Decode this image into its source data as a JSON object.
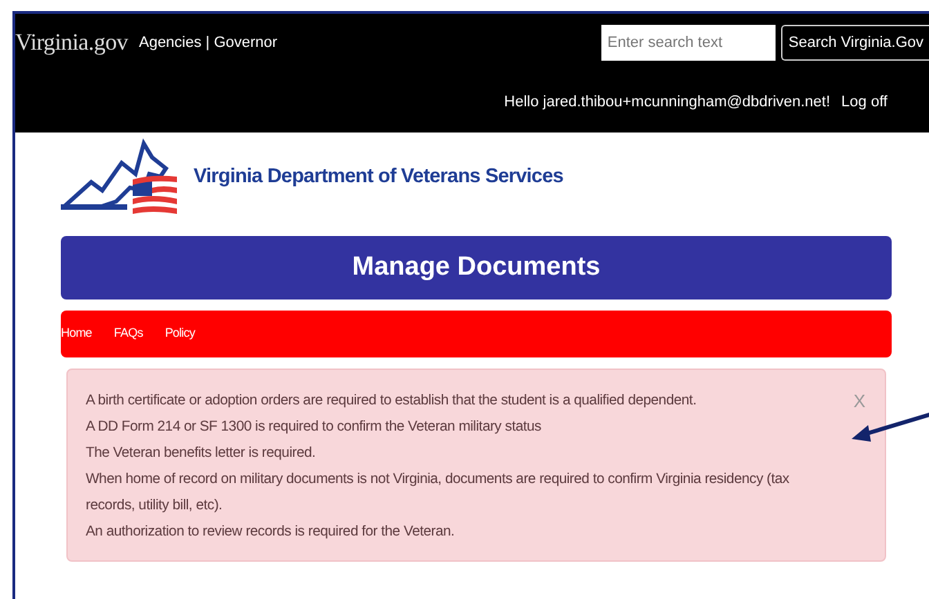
{
  "header": {
    "logo_text": "Virginia.gov",
    "links_text": "Agencies | Governor",
    "search": {
      "placeholder": "Enter search text",
      "button": "Search Virginia.Gov"
    },
    "greeting": "Hello jared.thibou+mcunningham@dbdriven.net!",
    "logoff": "Log off"
  },
  "agency": {
    "name": "Virginia Department of Veterans Services"
  },
  "page_title": "Manage Documents",
  "nav": [
    {
      "label": "Home"
    },
    {
      "label": "FAQs"
    },
    {
      "label": "Policy"
    }
  ],
  "alert": {
    "close": "X",
    "messages": [
      "A birth certificate or adoption orders are required to establish that the student is a qualified dependent.",
      "A DD Form 214 or SF 1300 is required to confirm the Veteran military status",
      "The Veteran benefits letter is required.",
      "When home of record on military documents is not Virginia, documents are required to confirm Virginia residency (tax records, utility bill, etc).",
      "An authorization to review records is required for the Veteran."
    ]
  }
}
